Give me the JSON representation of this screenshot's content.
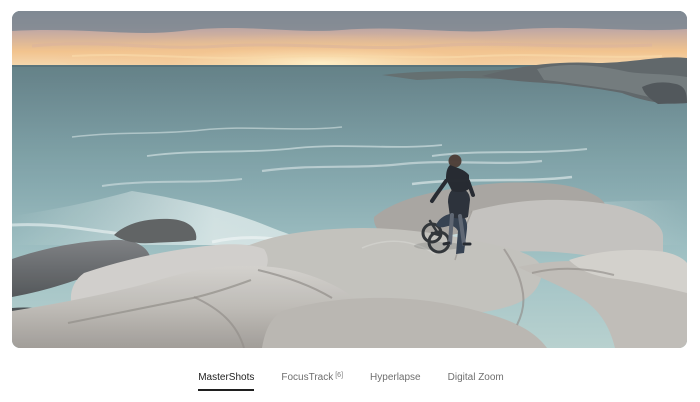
{
  "media": {
    "alt": "Person standing with a bicycle on rocks by the sea at sunset"
  },
  "tabs": [
    {
      "label": "MasterShots",
      "superscript": "",
      "active": true
    },
    {
      "label": "FocusTrack",
      "superscript": "[6]",
      "active": false
    },
    {
      "label": "Hyperlapse",
      "superscript": "",
      "active": false
    },
    {
      "label": "Digital Zoom",
      "superscript": "",
      "active": false
    }
  ]
}
